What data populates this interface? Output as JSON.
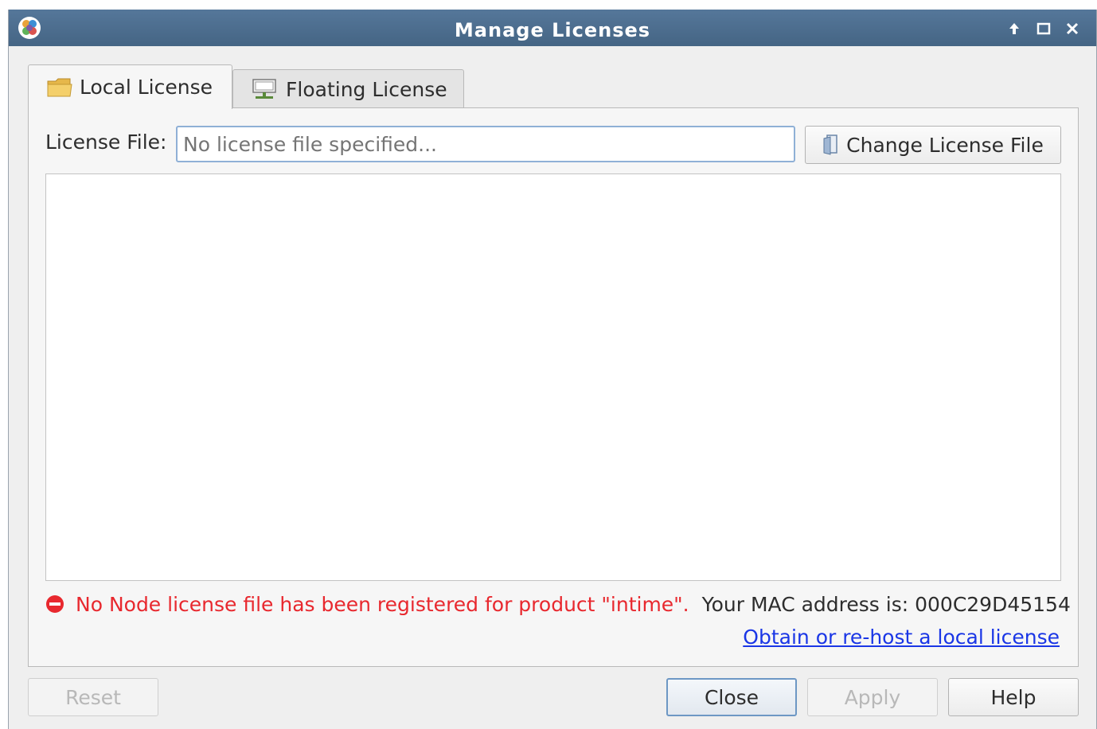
{
  "window": {
    "title": "Manage Licenses",
    "controls": [
      "pin-up-icon",
      "maximize-icon",
      "close-icon"
    ]
  },
  "tabs": [
    {
      "label": "Local License",
      "icon": "folder-icon",
      "active": true
    },
    {
      "label": "Floating License",
      "icon": "network-server-icon",
      "active": false
    }
  ],
  "license_file": {
    "label": "License File:",
    "value": "",
    "placeholder": "No license file specified...",
    "change_button": "Change License File"
  },
  "status": {
    "error_icon": "no-entry-icon",
    "error_message": "No Node license file has been registered for product \"intime\".",
    "mac_message": "Your MAC address is: 000C29D45154",
    "link_text": "Obtain or re-host a local license"
  },
  "buttons": {
    "reset": "Reset",
    "close": "Close",
    "apply": "Apply",
    "help": "Help"
  },
  "colors": {
    "titlebar": "#4a6a8a",
    "error": "#e8282e",
    "link": "#1a36e6"
  }
}
